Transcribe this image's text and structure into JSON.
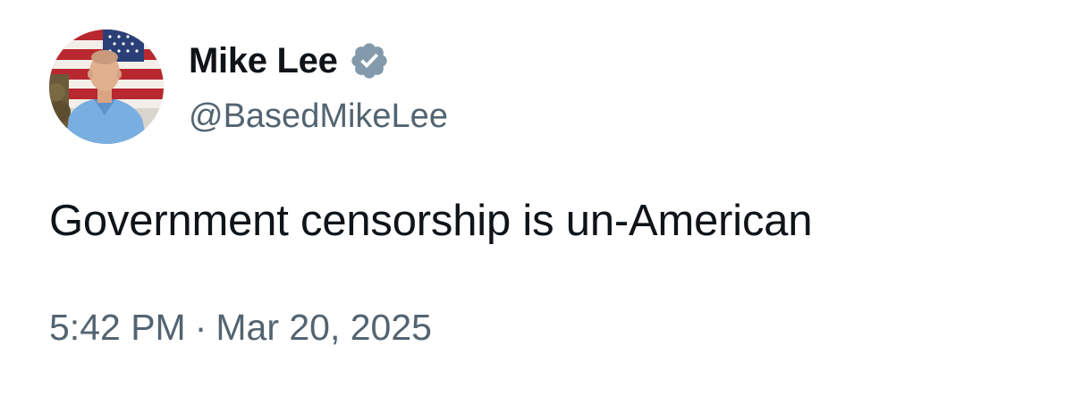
{
  "author": {
    "display_name": "Mike Lee",
    "handle": "@BasedMikeLee",
    "verified": true,
    "avatar_alt": "avatar",
    "verified_badge_color": "#829aab"
  },
  "tweet": {
    "text": "Government censorship is un-American"
  },
  "meta": {
    "time": "5:42 PM",
    "separator": "·",
    "date": "Mar 20, 2025"
  },
  "colors": {
    "background": "#ffffff",
    "primary_text": "#0f1419",
    "secondary_text": "#536471"
  },
  "icons": {
    "verified": "verified-badge-icon",
    "avatar": "profile-photo"
  }
}
